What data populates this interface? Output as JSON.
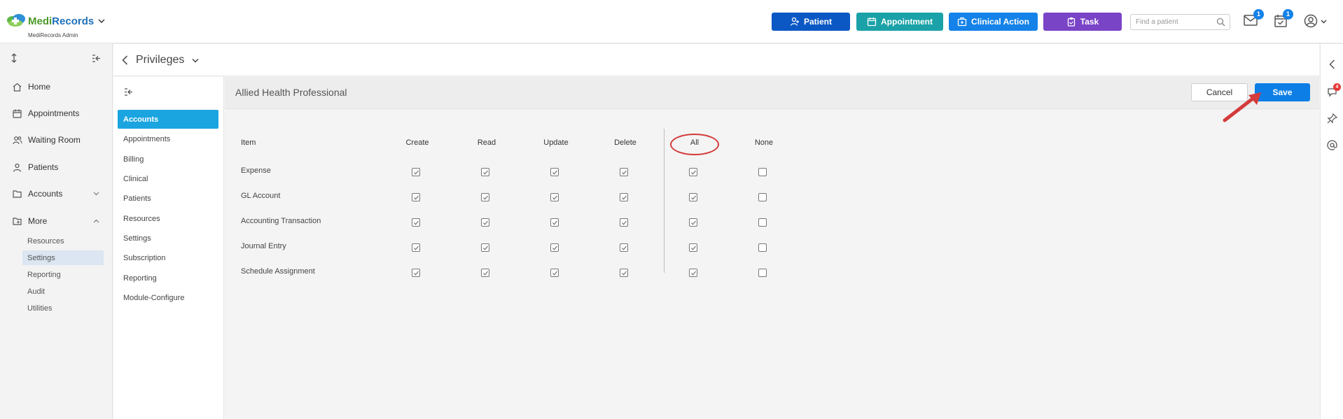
{
  "header": {
    "brand_name_part1": "Medi",
    "brand_name_part2": "Records",
    "brand_sub": "MediRecords Admin",
    "buttons": [
      {
        "label": "Patient",
        "color": "#0b58c4",
        "icon": "person-plus-icon"
      },
      {
        "label": "Appointment",
        "color": "#1aa2a8",
        "icon": "calendar-icon"
      },
      {
        "label": "Clinical Action",
        "color": "#1482e8",
        "icon": "medical-bag-icon"
      },
      {
        "label": "Task",
        "color": "#7a44c7",
        "icon": "clipboard-icon"
      }
    ],
    "search_placeholder": "Find a patient",
    "mail_badge": "1",
    "tasks_badge": "1"
  },
  "sidebar": {
    "items": [
      {
        "label": "Home",
        "icon": "home-icon"
      },
      {
        "label": "Appointments",
        "icon": "calendar-icon"
      },
      {
        "label": "Waiting Room",
        "icon": "people-icon"
      },
      {
        "label": "Patients",
        "icon": "person-icon"
      },
      {
        "label": "Accounts",
        "icon": "folder-icon",
        "chevron": "down"
      },
      {
        "label": "More",
        "icon": "folder-plus-icon",
        "chevron": "up"
      }
    ],
    "sub_items": [
      {
        "label": "Resources",
        "active": false
      },
      {
        "label": "Settings",
        "active": true
      },
      {
        "label": "Reporting",
        "active": false
      },
      {
        "label": "Audit",
        "active": false
      },
      {
        "label": "Utilities",
        "active": false
      }
    ]
  },
  "page": {
    "title": "Privileges"
  },
  "subnav": {
    "items": [
      {
        "label": "Accounts",
        "active": true
      },
      {
        "label": "Appointments",
        "active": false
      },
      {
        "label": "Billing",
        "active": false
      },
      {
        "label": "Clinical",
        "active": false
      },
      {
        "label": "Patients",
        "active": false
      },
      {
        "label": "Resources",
        "active": false
      },
      {
        "label": "Settings",
        "active": false
      },
      {
        "label": "Subscription",
        "active": false
      },
      {
        "label": "Reporting",
        "active": false
      },
      {
        "label": "Module-Configure",
        "active": false
      }
    ]
  },
  "main": {
    "role_title": "Allied Health Professional",
    "cancel_label": "Cancel",
    "save_label": "Save",
    "columns": [
      "Item",
      "Create",
      "Read",
      "Update",
      "Delete",
      "All",
      "None"
    ],
    "rows": [
      {
        "item": "Expense",
        "create": true,
        "read": true,
        "update": true,
        "delete": true,
        "all": true,
        "none": false
      },
      {
        "item": "GL Account",
        "create": true,
        "read": true,
        "update": true,
        "delete": true,
        "all": true,
        "none": false
      },
      {
        "item": "Accounting Transaction",
        "create": true,
        "read": true,
        "update": true,
        "delete": true,
        "all": true,
        "none": false
      },
      {
        "item": "Journal Entry",
        "create": true,
        "read": true,
        "update": true,
        "delete": true,
        "all": true,
        "none": false
      },
      {
        "item": "Schedule Assignment",
        "create": true,
        "read": true,
        "update": true,
        "delete": true,
        "all": true,
        "none": false
      }
    ]
  },
  "rail": {
    "chat_badge": "4"
  },
  "colors": {
    "accent_blue": "#0d7ee6",
    "active_subnav": "#1aa5e0",
    "annotation_red": "#d43b3b"
  }
}
